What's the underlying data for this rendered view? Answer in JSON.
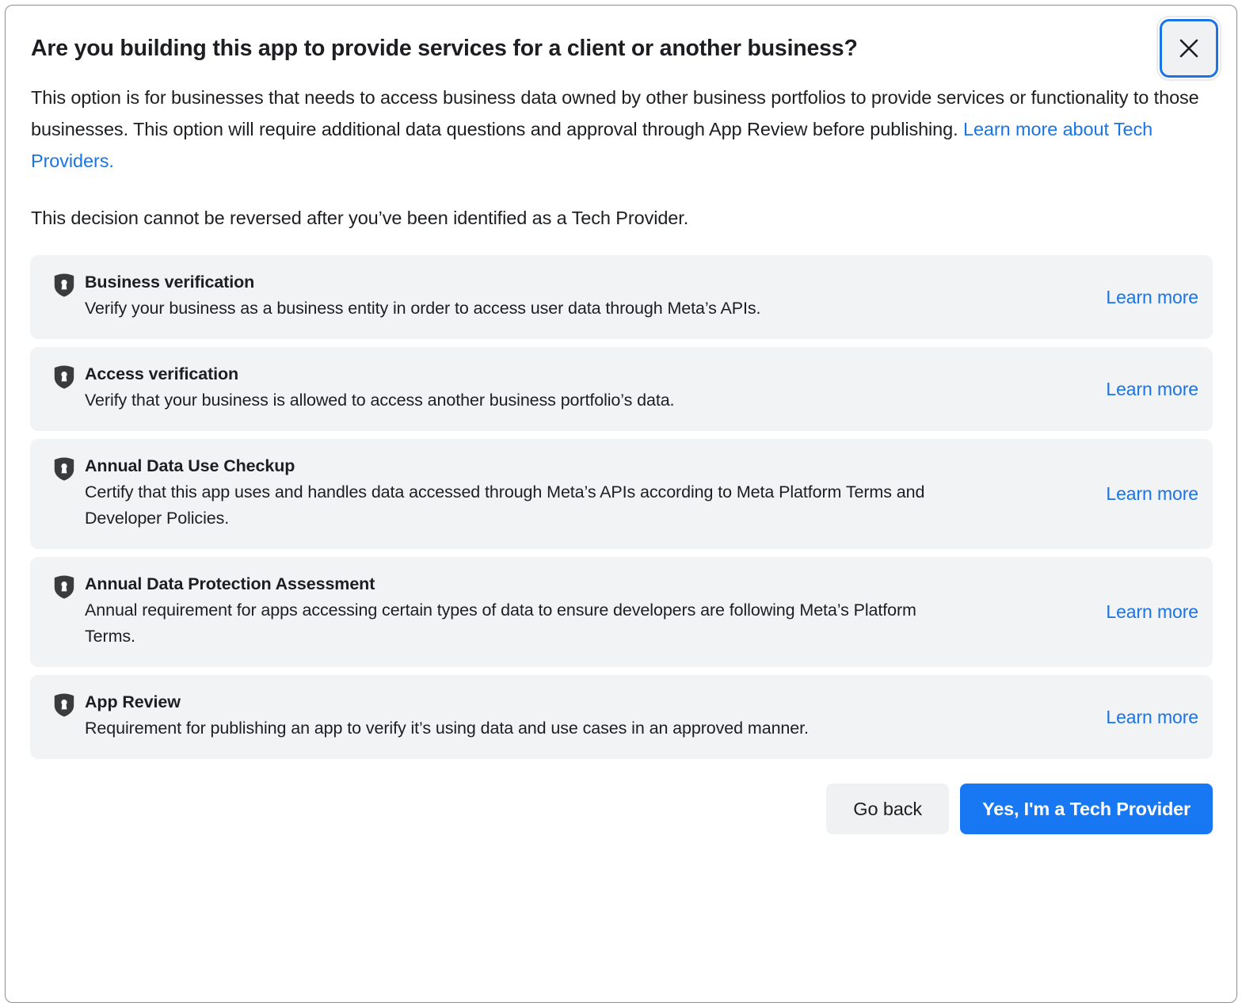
{
  "dialog": {
    "title": "Are you building this app to provide services for a client or another business?",
    "close_label": "Close",
    "paragraph_1_before_link": "This option is for businesses that needs to access business data owned by other business portfolios to provide services or functionality to those businesses. This option will require additional data questions and approval through App Review before publishing. ",
    "paragraph_1_link": "Learn more about Tech Providers.",
    "paragraph_2": "This decision cannot be reversed after you’ve been identified as a Tech Provider.",
    "requirements": [
      {
        "icon": "shield-lock-icon",
        "title": "Business verification",
        "description": "Verify your business as a business entity in order to access user data through Meta’s APIs.",
        "link_label": "Learn more"
      },
      {
        "icon": "shield-lock-icon",
        "title": "Access verification",
        "description": "Verify that your business is allowed to access another business portfolio’s data.",
        "link_label": "Learn more"
      },
      {
        "icon": "shield-lock-icon",
        "title": "Annual Data Use Checkup",
        "description": "Certify that this app uses and handles data accessed through Meta’s APIs according to Meta Platform Terms and Developer Policies.",
        "link_label": "Learn more"
      },
      {
        "icon": "shield-lock-icon",
        "title": "Annual Data Protection Assessment",
        "description": "Annual requirement for apps accessing certain types of data to ensure developers are following Meta’s Platform Terms.",
        "link_label": "Learn more"
      },
      {
        "icon": "shield-lock-icon",
        "title": "App Review",
        "description": "Requirement for publishing an app to verify it’s using data and use cases in an approved manner.",
        "link_label": "Learn more"
      }
    ],
    "footer": {
      "go_back_label": "Go back",
      "confirm_label": "Yes, I'm a Tech Provider"
    }
  },
  "colors": {
    "accent_blue": "#1877f2",
    "link_blue": "#1b74e4",
    "focus_ring": "#1b74e4",
    "card_bg": "#f2f3f5",
    "text_primary": "#1c1e21",
    "icon_dark": "#3a3b3c"
  }
}
